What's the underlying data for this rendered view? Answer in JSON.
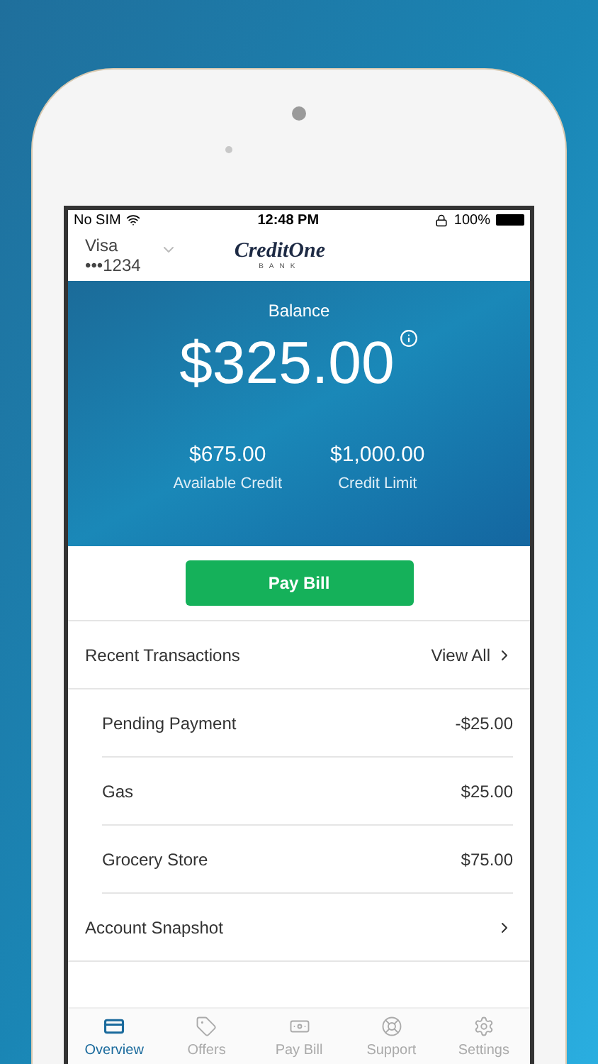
{
  "status_bar": {
    "carrier": "No SIM",
    "time": "12:48 PM",
    "battery": "100%"
  },
  "header": {
    "card": "Visa",
    "number": "•••1234",
    "logo": "CreditOne",
    "logo_tagline": "BANK"
  },
  "balance": {
    "label": "Balance",
    "amount": "$325.00",
    "stats": [
      {
        "value": "$675.00",
        "label": "Available Credit"
      },
      {
        "value": "$1,000.00",
        "label": "Credit Limit"
      }
    ]
  },
  "pay_button": "Pay Bill",
  "recent": {
    "title": "Recent Transactions",
    "link": "View All",
    "transactions": [
      {
        "name": "Pending Payment",
        "amount": "-$25.00"
      },
      {
        "name": "Gas",
        "amount": "$25.00"
      },
      {
        "name": "Grocery Store",
        "amount": "$75.00"
      }
    ]
  },
  "snapshot": {
    "title": "Account Snapshot"
  },
  "tab_bar": [
    {
      "kind": "card",
      "label": "Overview",
      "selected": true
    },
    {
      "kind": "tag",
      "label": "Offers",
      "selected": false
    },
    {
      "kind": "money",
      "label": "Pay Bill",
      "selected": false
    },
    {
      "kind": "lifebuoy",
      "label": "Support",
      "selected": false
    },
    {
      "kind": "gear",
      "label": "Settings",
      "selected": false
    }
  ]
}
